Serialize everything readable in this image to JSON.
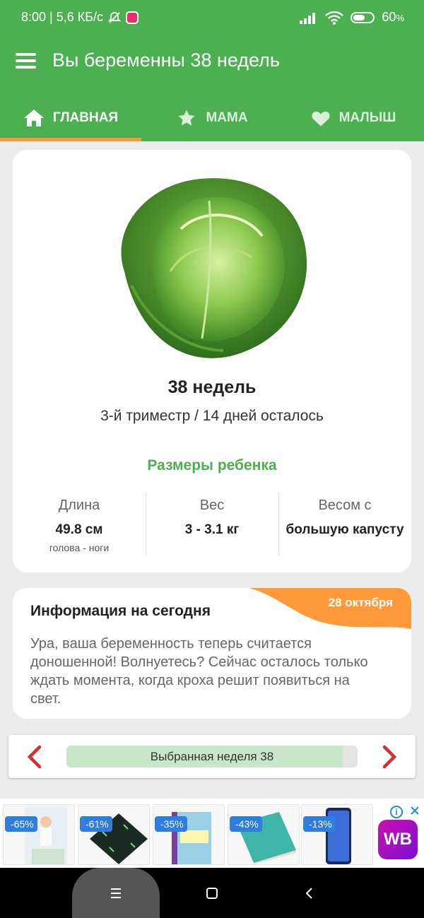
{
  "status_bar": {
    "time_speed": "8:00 | 5,6 КБ/с",
    "battery": "60",
    "battery_unit": "%",
    "battery_level": 0.6
  },
  "header": {
    "title": "Вы беременны 38 недель"
  },
  "tabs": [
    {
      "label": "ГЛАВНАЯ",
      "icon": "home-icon",
      "active": true
    },
    {
      "label": "МАМА",
      "icon": "star-icon",
      "active": false
    },
    {
      "label": "МАЛЫШ",
      "icon": "heart-icon",
      "active": false
    }
  ],
  "main_card": {
    "image": "cabbage",
    "week_title": "38 недель",
    "subtitle": "3-й триместр / 14 дней осталось",
    "sizes_title": "Размеры ребенка",
    "stats": [
      {
        "label": "Длина",
        "value": "49.8 см",
        "note": "голова - ноги"
      },
      {
        "label": "Вес",
        "value": "3 - 3.1 кг",
        "note": ""
      },
      {
        "label": "Весом с",
        "value": "большую капусту",
        "note": ""
      }
    ]
  },
  "info_card": {
    "date": "28 октября",
    "title": "Информация на сегодня",
    "text": "Ура, ваша беременность теперь считается доношенной! Волнуетесь? Сейчас осталось только ждать момента, когда кроха решит появиться на свет."
  },
  "week_selector": {
    "label": "Выбранная неделя 38",
    "progress": 0.95
  },
  "ads": {
    "items": [
      {
        "discount": "-65%"
      },
      {
        "discount": "-61%"
      },
      {
        "discount": "-35%"
      },
      {
        "discount": "-43%"
      },
      {
        "discount": "-13%"
      }
    ],
    "brand": "WB"
  },
  "colors": {
    "primary": "#4caf50",
    "accent": "#ff9a3c",
    "arrow": "#d32f2f"
  }
}
